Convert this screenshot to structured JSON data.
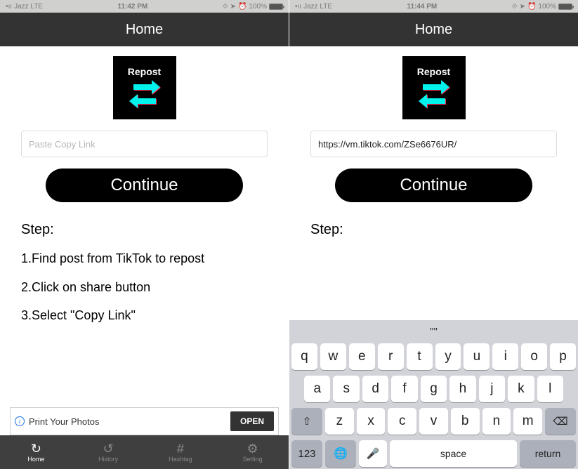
{
  "left": {
    "status": {
      "carrier": "Jazz LTE",
      "time": "11:42 PM",
      "battery": "100%"
    },
    "header": "Home",
    "repost_label": "Repost",
    "input_placeholder": "Paste Copy Link",
    "input_value": "",
    "continue_label": "Continue",
    "steps_title": "Step:",
    "steps": [
      "1.Find post from TikTok to repost",
      "2.Click on share button",
      "3.Select \"Copy Link\""
    ],
    "ad": {
      "text": "Print Your Photos",
      "button": "OPEN"
    },
    "tabs": [
      {
        "icon": "↻",
        "label": "Home",
        "active": true
      },
      {
        "icon": "↺",
        "label": "History",
        "active": false
      },
      {
        "icon": "#",
        "label": "Hashtag",
        "active": false
      },
      {
        "icon": "⚙",
        "label": "Setting",
        "active": false
      }
    ]
  },
  "right": {
    "status": {
      "carrier": "Jazz LTE",
      "time": "11:44 PM",
      "battery": "100%"
    },
    "header": "Home",
    "repost_label": "Repost",
    "input_placeholder": "Paste Copy Link",
    "input_value": "https://vm.tiktok.com/ZSe6676UR/",
    "continue_label": "Continue",
    "steps_title": "Step:",
    "keyboard": {
      "hint": "\"\"",
      "row1": [
        "q",
        "w",
        "e",
        "r",
        "t",
        "y",
        "u",
        "i",
        "o",
        "p"
      ],
      "row2": [
        "a",
        "s",
        "d",
        "f",
        "g",
        "h",
        "j",
        "k",
        "l"
      ],
      "shift": "⇧",
      "row3": [
        "z",
        "x",
        "c",
        "v",
        "b",
        "n",
        "m"
      ],
      "backspace": "⌫",
      "k123": "123",
      "globe": "🌐",
      "mic": "🎤",
      "space": "space",
      "return": "return"
    }
  }
}
